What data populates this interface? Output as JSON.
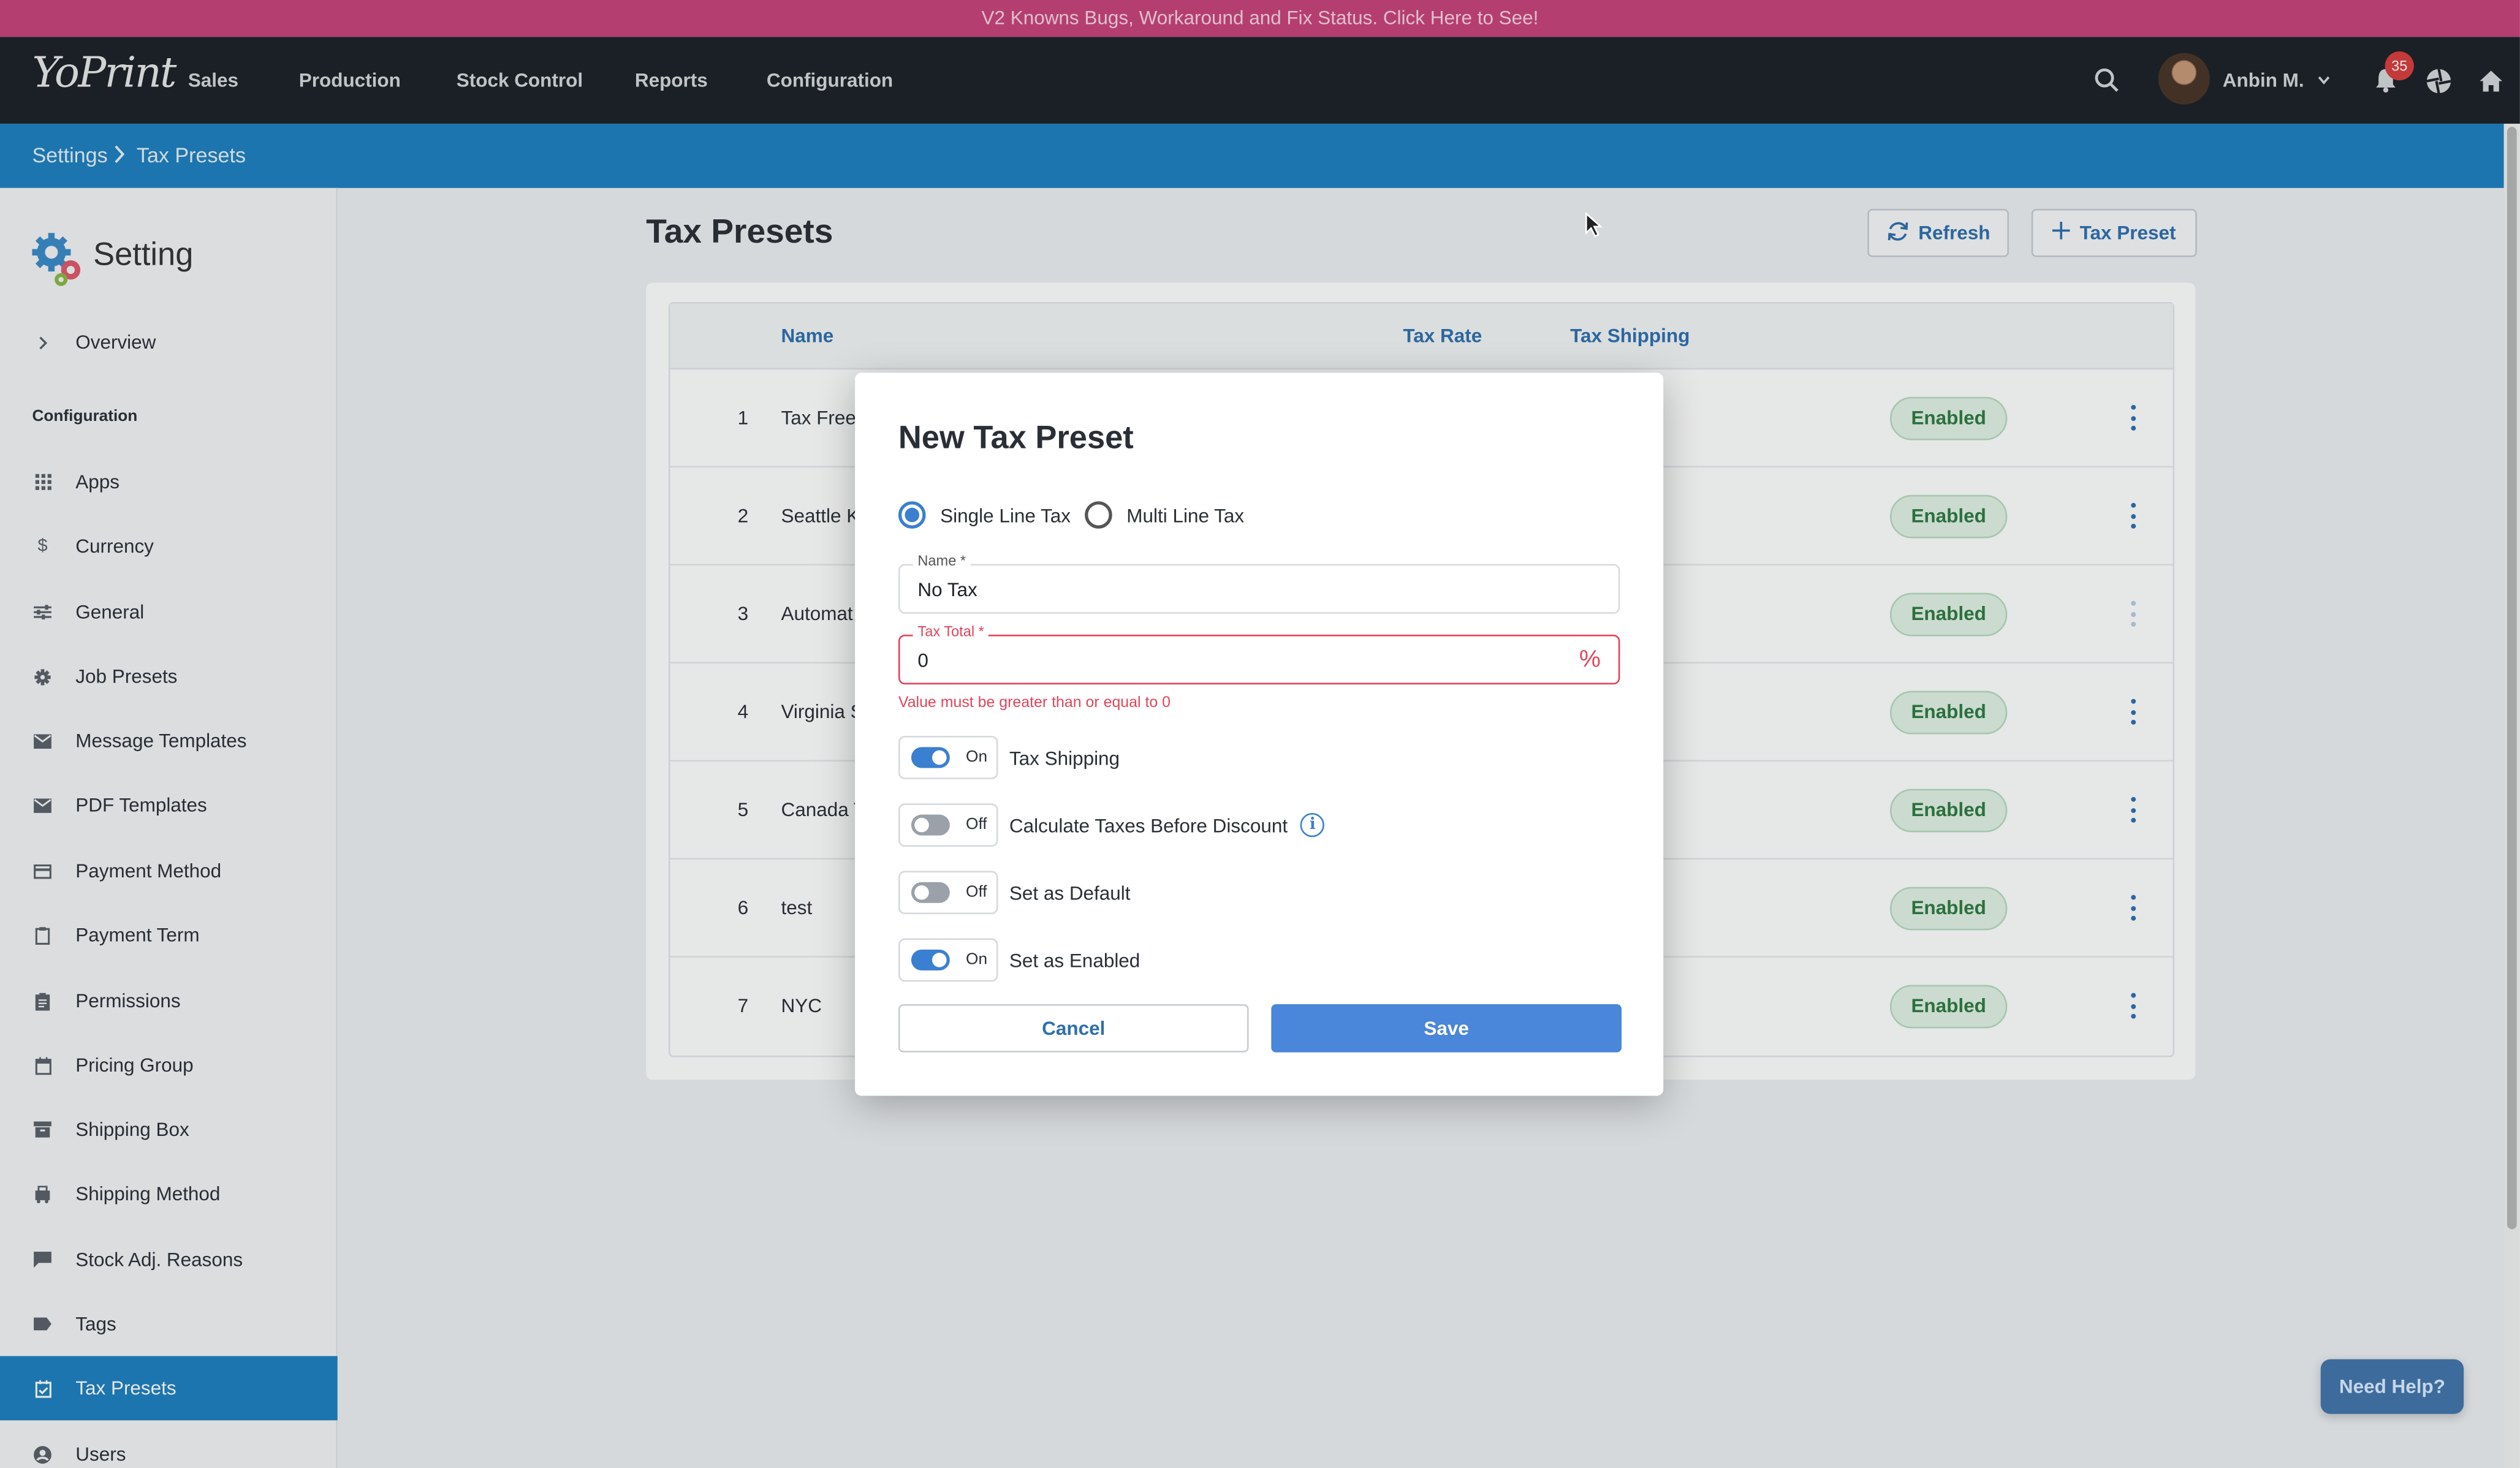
{
  "banner": {
    "text": "V2 Knowns Bugs, Workaround and Fix Status. Click Here to See!"
  },
  "topbar": {
    "logo": "YoPrint",
    "nav": [
      "Sales",
      "Production",
      "Stock Control",
      "Reports",
      "Configuration"
    ],
    "user_name": "Anbin M.",
    "notification_count": "35",
    "icons": [
      "search-icon",
      "chevron-down-icon",
      "bell-icon",
      "aperture-icon",
      "home-icon"
    ]
  },
  "breadcrumb": {
    "items": [
      "Settings",
      "Tax Presets"
    ]
  },
  "sidebar": {
    "title": "Setting",
    "overview": "Overview",
    "section": "Configuration",
    "items": [
      {
        "label": "Apps",
        "icon": "grid-icon"
      },
      {
        "label": "Currency",
        "icon": "dollar-icon"
      },
      {
        "label": "General",
        "icon": "sliders-icon"
      },
      {
        "label": "Job Presets",
        "icon": "gear-icon"
      },
      {
        "label": "Message Templates",
        "icon": "mail-icon"
      },
      {
        "label": "PDF Templates",
        "icon": "mail-icon"
      },
      {
        "label": "Payment Method",
        "icon": "card-icon"
      },
      {
        "label": "Payment Term",
        "icon": "clipboard-icon"
      },
      {
        "label": "Permissions",
        "icon": "clipboard-icon"
      },
      {
        "label": "Pricing Group",
        "icon": "calendar-icon"
      },
      {
        "label": "Shipping Box",
        "icon": "archive-icon"
      },
      {
        "label": "Shipping Method",
        "icon": "truck-icon"
      },
      {
        "label": "Stock Adj. Reasons",
        "icon": "comment-icon"
      },
      {
        "label": "Tags",
        "icon": "tag-icon"
      },
      {
        "label": "Tax Presets",
        "icon": "calendar-check-icon",
        "active": true
      },
      {
        "label": "Users",
        "icon": "user-icon"
      }
    ]
  },
  "main": {
    "title": "Tax Presets",
    "refresh_label": "Refresh",
    "add_label": "Tax Preset",
    "table": {
      "headers": [
        "Name",
        "Tax Rate",
        "Tax Shipping"
      ],
      "rows": [
        {
          "num": "1",
          "name": "Tax Free",
          "status": "Enabled"
        },
        {
          "num": "2",
          "name": "Seattle K",
          "status": "Enabled"
        },
        {
          "num": "3",
          "name": "Automat",
          "status": "Enabled"
        },
        {
          "num": "4",
          "name": "Virginia S",
          "status": "Enabled"
        },
        {
          "num": "5",
          "name": "Canada T",
          "status": "Enabled"
        },
        {
          "num": "6",
          "name": "test",
          "status": "Enabled"
        },
        {
          "num": "7",
          "name": "NYC",
          "status": "Enabled"
        }
      ]
    }
  },
  "modal": {
    "title": "New Tax Preset",
    "radio_single": "Single Line Tax",
    "radio_multi": "Multi Line Tax",
    "name_label": "Name *",
    "name_value": "No Tax",
    "tax_label": "Tax Total *",
    "tax_value": "0",
    "tax_suffix": "%",
    "error": "Value must be greater than or equal to 0",
    "toggles": [
      {
        "state": "On",
        "label": "Tax Shipping"
      },
      {
        "state": "Off",
        "label": "Calculate Taxes Before Discount"
      },
      {
        "state": "Off",
        "label": "Set as Default"
      },
      {
        "state": "On",
        "label": "Set as Enabled"
      }
    ],
    "cancel_label": "Cancel",
    "save_label": "Save"
  },
  "help_label": "Need Help?",
  "colors": {
    "accent": "#1d7fbf",
    "banner": "#c8427a",
    "topbar": "#1b2027",
    "primary_button": "#4a86d9",
    "error": "#e0455a",
    "enabled_pill": "#e2f2e5"
  }
}
